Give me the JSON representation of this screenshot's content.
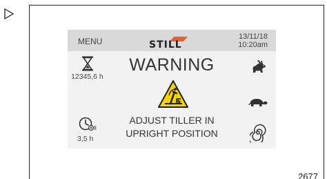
{
  "figure": {
    "number": "2677"
  },
  "display": {
    "header": {
      "menu_label": "MENU",
      "brand": "STILL",
      "date": "13/11/18",
      "time": "10:20am"
    },
    "left_panel": {
      "operating_hours": "12345,6 h",
      "service_hours": "3,5 h"
    },
    "warning": {
      "title": "WARNING",
      "line1": "ADJUST TILLER IN",
      "line2": "UPRIGHT POSITION"
    },
    "right_panel": {
      "icons": [
        "rabbit-icon",
        "turtle-icon",
        "spiral-icon"
      ]
    },
    "colors": {
      "warning_yellow": "#f5d400",
      "brand_orange": "#e8612c"
    }
  }
}
